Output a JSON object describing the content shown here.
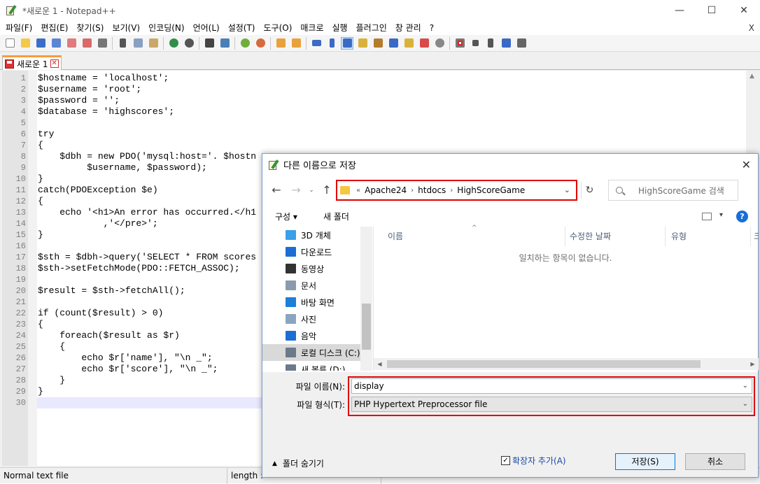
{
  "window": {
    "title": "*새로운 1 - Notepad++",
    "minimize": "—",
    "maximize": "☐",
    "close": "✕"
  },
  "menu": {
    "items": [
      "파일(F)",
      "편집(E)",
      "찾기(S)",
      "보기(V)",
      "인코딩(N)",
      "언어(L)",
      "설정(T)",
      "도구(O)",
      "매크로",
      "실행",
      "플러그인",
      "창 관리",
      "?"
    ],
    "close": "X"
  },
  "tab": {
    "label": "새로운 1",
    "close": "✕"
  },
  "editor": {
    "lines": [
      {
        "n": "1",
        "text": "$hostname = 'localhost';"
      },
      {
        "n": "2",
        "text": "$username = 'root';"
      },
      {
        "n": "3",
        "text": "$password = '';"
      },
      {
        "n": "4",
        "text": "$database = 'highscores';"
      },
      {
        "n": "5",
        "text": ""
      },
      {
        "n": "6",
        "text": "try"
      },
      {
        "n": "7",
        "text": "{"
      },
      {
        "n": "8",
        "text": "    $dbh = new PDO('mysql:host='. $hostn"
      },
      {
        "n": "9",
        "text": "         $username, $password);"
      },
      {
        "n": "10",
        "text": "}"
      },
      {
        "n": "11",
        "text": "catch(PDOException $e)"
      },
      {
        "n": "12",
        "text": "{"
      },
      {
        "n": "13",
        "text": "    echo '<h1>An error has occurred.</h1"
      },
      {
        "n": "14",
        "text": "            ,'</pre>';"
      },
      {
        "n": "15",
        "text": "}"
      },
      {
        "n": "16",
        "text": ""
      },
      {
        "n": "17",
        "text": "$sth = $dbh->query('SELECT * FROM scores"
      },
      {
        "n": "18",
        "text": "$sth->setFetchMode(PDO::FETCH_ASSOC);"
      },
      {
        "n": "19",
        "text": ""
      },
      {
        "n": "20",
        "text": "$result = $sth->fetchAll();"
      },
      {
        "n": "21",
        "text": ""
      },
      {
        "n": "22",
        "text": "if (count($result) > 0)"
      },
      {
        "n": "23",
        "text": "{"
      },
      {
        "n": "24",
        "text": "    foreach($result as $r)"
      },
      {
        "n": "25",
        "text": "    {"
      },
      {
        "n": "26",
        "text": "        echo $r['name'], \"\\n _\";"
      },
      {
        "n": "27",
        "text": "        echo $r['score'], \"\\n _\";"
      },
      {
        "n": "28",
        "text": "    }"
      },
      {
        "n": "29",
        "text": "}"
      },
      {
        "n": "30",
        "text": ""
      }
    ]
  },
  "status": {
    "file_type": "Normal text file",
    "length": "length : "
  },
  "dialog": {
    "title": "다른 이름으로 저장",
    "close": "✕",
    "address": {
      "prefix": "«",
      "crumbs": [
        "Apache24",
        "htdocs",
        "HighScoreGame"
      ]
    },
    "search_placeholder": "HighScoreGame 검색",
    "organize": "구성 ▾",
    "new_folder": "새 폴더",
    "help": "?",
    "nav_items": [
      {
        "label": "3D 개체",
        "color": "#3aa0e8"
      },
      {
        "label": "다운로드",
        "color": "#1c6fd1"
      },
      {
        "label": "동영상",
        "color": "#333333"
      },
      {
        "label": "문서",
        "color": "#8a9bb0"
      },
      {
        "label": "바탕 화면",
        "color": "#1e7fd8"
      },
      {
        "label": "사진",
        "color": "#8aa5c0"
      },
      {
        "label": "음악",
        "color": "#1c6fd1"
      },
      {
        "label": "로컬 디스크 (C:)",
        "color": "#6a7a8a"
      },
      {
        "label": "새 볼륨 (D:)",
        "color": "#6a7a8a"
      }
    ],
    "columns": [
      "이름",
      "수정한 날짜",
      "유형",
      "크"
    ],
    "empty_message": "일치하는 항목이 없습니다.",
    "filename_label": "파일 이름(N):",
    "filename_value": "display",
    "filetype_label": "파일 형식(T):",
    "filetype_value": "PHP Hypertext Preprocessor file",
    "hide_folders": "폴더 숨기기",
    "add_extension": "확장자 추가(A)",
    "add_extension_checked": "✓",
    "save": "저장(S)",
    "cancel": "취소"
  },
  "colors": {
    "highlight_red": "#e00000",
    "tab_accent": "#f79d3c",
    "current_line": "#e8e8ff"
  }
}
